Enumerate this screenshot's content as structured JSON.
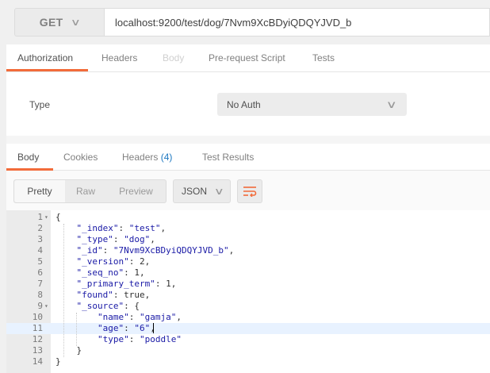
{
  "request": {
    "method": "GET",
    "url": "localhost:9200/test/dog/7Nvm9XcBDyiQDQYJVD_b"
  },
  "request_tabs": [
    {
      "label": "Authorization",
      "state": "active"
    },
    {
      "label": "Headers",
      "state": "normal"
    },
    {
      "label": "Body",
      "state": "disabled"
    },
    {
      "label": "Pre-request Script",
      "state": "normal"
    },
    {
      "label": "Tests",
      "state": "normal"
    }
  ],
  "auth": {
    "type_label": "Type",
    "selected": "No Auth"
  },
  "response_tabs": [
    {
      "label": "Body",
      "state": "active"
    },
    {
      "label": "Cookies",
      "state": "normal"
    },
    {
      "label": "Headers",
      "count": "(4)",
      "state": "normal"
    },
    {
      "label": "Test Results",
      "state": "normal"
    }
  ],
  "view_modes": [
    "Pretty",
    "Raw",
    "Preview"
  ],
  "active_view_mode": "Pretty",
  "format": "JSON",
  "icons": {
    "method_dropdown": "chevron-down-icon",
    "wrap": "wrap-lines-icon"
  },
  "colors": {
    "accent": "#f26b3a",
    "count_blue": "#1d78c1",
    "json_blue": "#1a1aa6",
    "active_line": "#e8f2ff"
  },
  "code_lines": [
    {
      "n": "1",
      "fold": true,
      "text": "{"
    },
    {
      "n": "2",
      "text": "    \"_index\": \"test\","
    },
    {
      "n": "3",
      "text": "    \"_type\": \"dog\","
    },
    {
      "n": "4",
      "text": "    \"_id\": \"7Nvm9XcBDyiQDQYJVD_b\","
    },
    {
      "n": "5",
      "text": "    \"_version\": 2,"
    },
    {
      "n": "6",
      "text": "    \"_seq_no\": 1,"
    },
    {
      "n": "7",
      "text": "    \"_primary_term\": 1,"
    },
    {
      "n": "8",
      "text": "    \"found\": true,"
    },
    {
      "n": "9",
      "fold": true,
      "text": "    \"_source\": {"
    },
    {
      "n": "10",
      "text": "        \"name\": \"gamja\","
    },
    {
      "n": "11",
      "text": "        \"age\": \"6\",",
      "active": true
    },
    {
      "n": "12",
      "text": "        \"type\": \"poddle\""
    },
    {
      "n": "13",
      "text": "    }"
    },
    {
      "n": "14",
      "text": "}"
    }
  ]
}
